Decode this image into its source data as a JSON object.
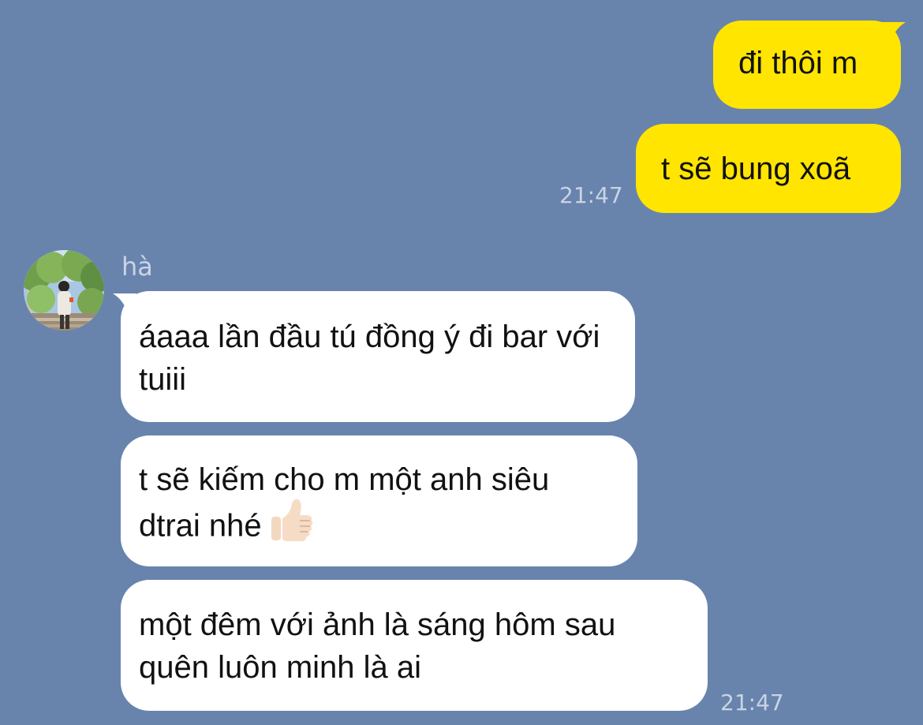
{
  "chat": {
    "messages_out": [
      {
        "text": "đi thôi m"
      },
      {
        "text": "t sẽ bung xoã"
      }
    ],
    "time_out": "21:47",
    "contact": {
      "name": "hà",
      "avatar": "avatar-photo"
    },
    "messages_in": [
      {
        "text": "áaaa lần đầu tú đồng ý đi bar với tuiii"
      },
      {
        "text": "t sẽ kiếm cho m một anh siêu dtrai nhé"
      },
      {
        "text": "một đêm với ảnh là sáng hôm sau quên luôn minh là ai"
      }
    ],
    "emoji": "thumbs-up-icon",
    "time_in": "21:47"
  },
  "colors": {
    "background": "#6884ad",
    "outgoing_bubble": "#ffe500",
    "incoming_bubble": "#ffffff",
    "meta_text": "#c9d4e4"
  }
}
